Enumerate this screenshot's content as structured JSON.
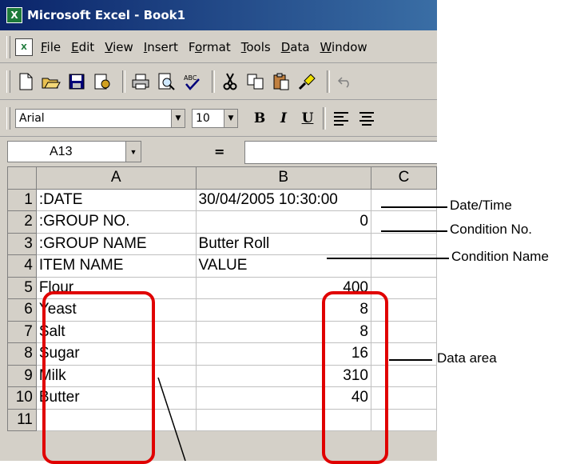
{
  "window": {
    "title": "Microsoft Excel - Book1",
    "app_icon": "excel-icon"
  },
  "menu": [
    "File",
    "Edit",
    "View",
    "Insert",
    "Format",
    "Tools",
    "Data",
    "Window"
  ],
  "toolbar": {
    "icons": [
      "new-icon",
      "open-icon",
      "save-icon",
      "permission-icon",
      "print-icon",
      "print-preview-icon",
      "spelling-icon",
      "cut-icon",
      "copy-icon",
      "paste-icon",
      "format-painter-icon",
      "undo-icon"
    ]
  },
  "format": {
    "font": "Arial",
    "size": "10",
    "bold": "B",
    "italic": "I",
    "underline": "U"
  },
  "namebox": {
    "value": "A13",
    "equals": "="
  },
  "columns": [
    "A",
    "B",
    "C"
  ],
  "rows": [
    {
      "n": "1",
      "a": ":DATE",
      "b": "30/04/2005 10:30:00",
      "b_num": false
    },
    {
      "n": "2",
      "a": ":GROUP NO.",
      "b": "0",
      "b_num": true
    },
    {
      "n": "3",
      "a": ":GROUP NAME",
      "b": "Butter Roll",
      "b_num": false
    },
    {
      "n": "4",
      "a": "ITEM NAME",
      "b": "VALUE",
      "b_num": false
    },
    {
      "n": "5",
      "a": "Flour",
      "b": "400",
      "b_num": true
    },
    {
      "n": "6",
      "a": "Yeast",
      "b": "8",
      "b_num": true
    },
    {
      "n": "7",
      "a": "Salt",
      "b": "8",
      "b_num": true
    },
    {
      "n": "8",
      "a": "Sugar",
      "b": "16",
      "b_num": true
    },
    {
      "n": "9",
      "a": "Milk",
      "b": "310",
      "b_num": true
    },
    {
      "n": "10",
      "a": "Butter",
      "b": "40",
      "b_num": true
    },
    {
      "n": "11",
      "a": "",
      "b": "",
      "b_num": false
    }
  ],
  "annotations": {
    "date_time": "Date/Time",
    "condition_no": "Condition No.",
    "condition_name": "Condition Name",
    "data_area": "Data area"
  },
  "colors": {
    "highlight": "#e00000",
    "titlebar": "#0a246a"
  }
}
